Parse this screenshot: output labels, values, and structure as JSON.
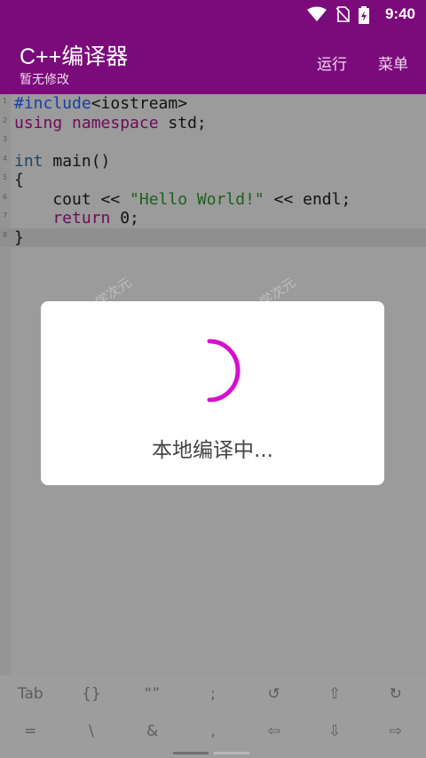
{
  "status": {
    "time": "9:40"
  },
  "appbar": {
    "title": "C++编译器",
    "subtitle": "暂无修改",
    "run_label": "运行",
    "menu_label": "菜单"
  },
  "editor": {
    "line_numbers": [
      "1",
      "2",
      "3",
      "4",
      "5",
      "6",
      "7",
      "8"
    ],
    "l1_pp": "#include",
    "l1_rest": "<iostream>",
    "l2_kw": "using",
    "l2_ty": "namespace",
    "l2_rest": " std;",
    "l4_ty": "int",
    "l4_rest": " main()",
    "l5_rest": "{",
    "l6_pre": "    cout << ",
    "l6_str": "\"Hello World!\"",
    "l6_post": " << endl;",
    "l7_kw": "    return",
    "l7_rest": " 0;",
    "l8_rest": "}"
  },
  "watermark": {
    "text": "学次元"
  },
  "dialog": {
    "message": "本地编译中..."
  },
  "keyboard": {
    "row1": [
      "Tab",
      "{}",
      "“”",
      ";",
      "↺",
      "⇧",
      "↻"
    ],
    "row2": [
      "=",
      "\\",
      "&",
      ",",
      "⇦",
      "⇩",
      "⇨"
    ]
  },
  "colors": {
    "primary": "#7b0b7b",
    "spinner": "#d60fd0"
  }
}
